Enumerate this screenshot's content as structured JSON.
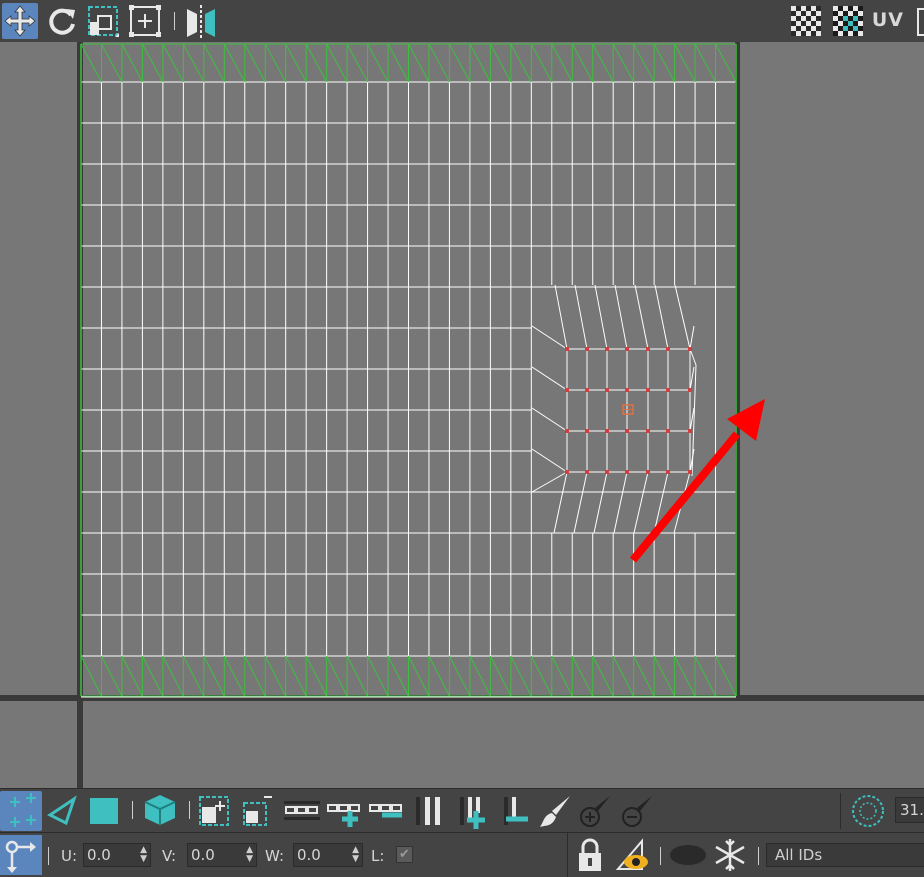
{
  "toolbar": {
    "uv_label": "UV",
    "icons": [
      "move-icon",
      "rotate-icon",
      "scale-icon",
      "freeform-icon",
      "mirror-icon",
      "checker-pattern-icon",
      "checker-map-icon",
      "uv-panel-icon"
    ]
  },
  "colors": {
    "accent": "#3fbfbf",
    "active_button": "#5b86bd",
    "viewport_bg": "#777777",
    "mesh_edge": "#ffffff",
    "seam_edge": "#3fbf3f",
    "selected_vertex": "#d04040",
    "annotation_arrow": "#ff0000"
  },
  "selection_bar": {
    "icons": [
      "vertex-select-icon",
      "edge-select-icon",
      "polygon-select-icon",
      "element-select-icon",
      "grow-selection-icon",
      "shrink-selection-icon",
      "loop-icon",
      "loop-grow-icon",
      "loop-shrink-icon",
      "ring-icon",
      "ring-grow-icon",
      "ring-shrink-icon",
      "paint-select-icon",
      "paint-add-icon",
      "paint-remove-icon",
      "soft-selection-icon"
    ],
    "zoom_value": "31."
  },
  "transform_bar": {
    "u_label": "U:",
    "u_value": "0.0",
    "v_label": "V:",
    "v_value": "0.0",
    "w_label": "W:",
    "w_value": "0.0",
    "l_label": "L:",
    "l_checked": true,
    "id_filter": "All IDs"
  }
}
